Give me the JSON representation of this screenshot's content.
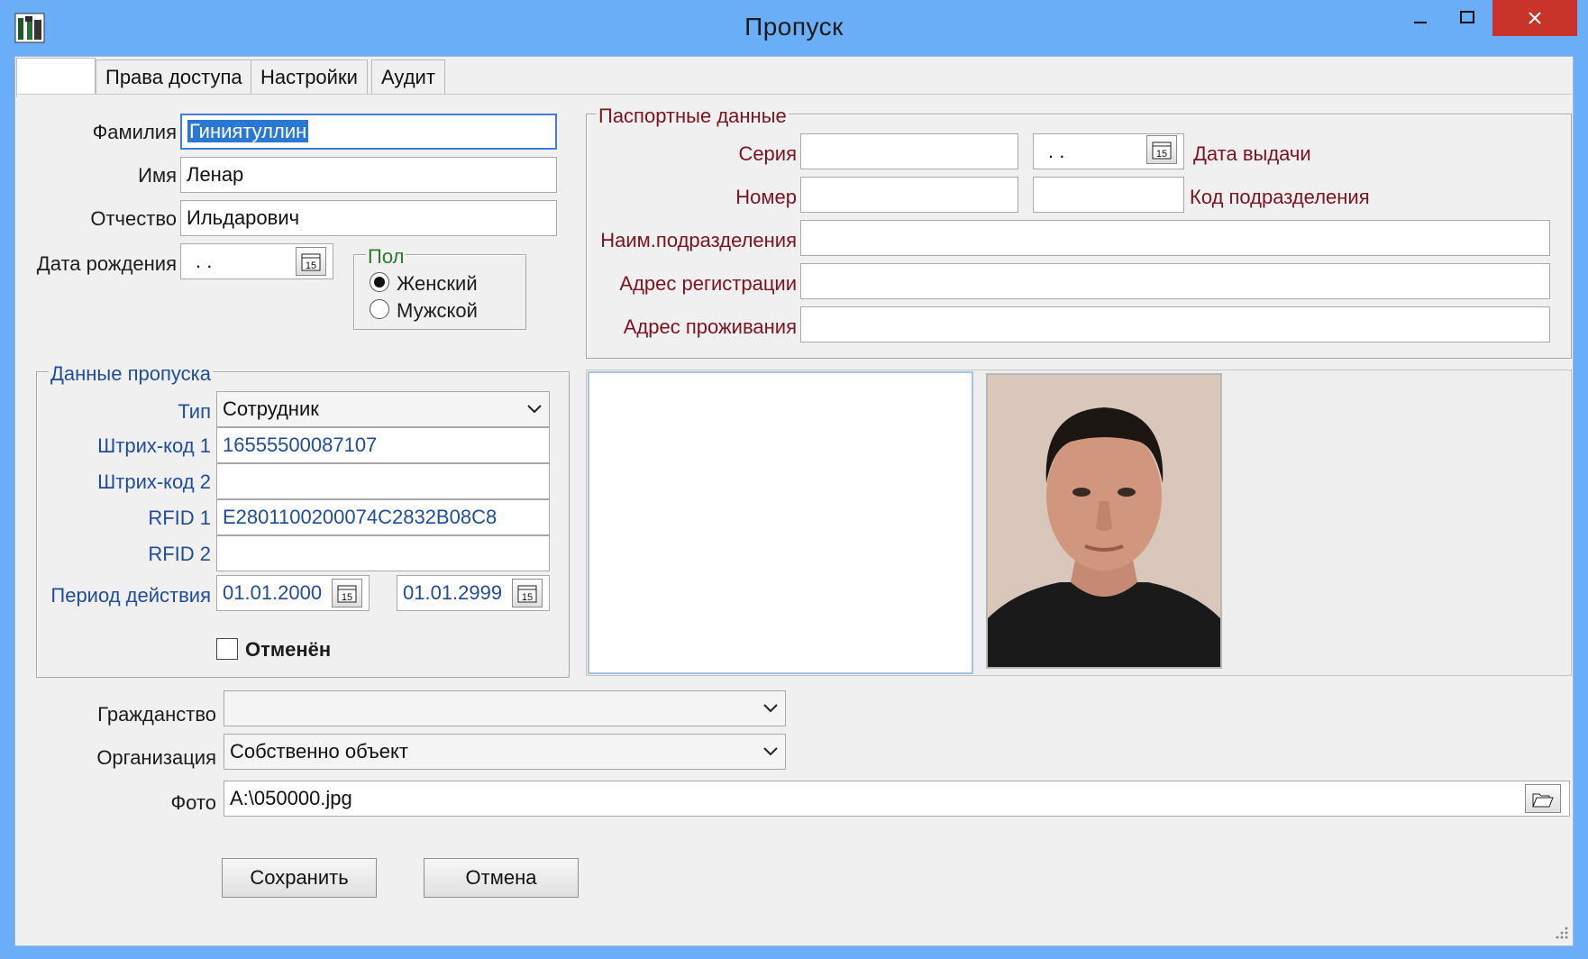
{
  "window": {
    "title": "Пропуск"
  },
  "tabs": [
    {
      "label": ""
    },
    {
      "label": "Права доступа"
    },
    {
      "label": "Настройки"
    },
    {
      "label": "Аудит"
    }
  ],
  "person": {
    "surname_label": "Фамилия",
    "surname_value": "Гиниятуллин",
    "name_label": "Имя",
    "name_value": "Ленар",
    "patronymic_label": "Отчество",
    "patronymic_value": "Ильдарович",
    "birth_label": "Дата рождения",
    "birth_value": ". ."
  },
  "gender": {
    "title": "Пол",
    "options": [
      {
        "label": "Женский",
        "selected": true
      },
      {
        "label": "Мужской",
        "selected": false
      }
    ]
  },
  "passport": {
    "title": "Паспортные данные",
    "series_label": "Серия",
    "series_value": "",
    "issue_date_value": ". .",
    "issue_date_label": "Дата выдачи",
    "number_label": "Номер",
    "number_value": "",
    "dept_code_value": "",
    "dept_code_label": "Код подразделения",
    "dept_name_label": "Наим.подразделения",
    "dept_name_value": "",
    "reg_addr_label": "Адрес регистрации",
    "reg_addr_value": "",
    "live_addr_label": "Адрес проживания",
    "live_addr_value": ""
  },
  "pass": {
    "title": "Данные пропуска",
    "type_label": "Тип",
    "type_value": "Сотрудник",
    "barcode1_label": "Штрих-код 1",
    "barcode1_value": "16555500087107",
    "barcode2_label": "Штрих-код 2",
    "barcode2_value": "",
    "rfid1_label": "RFID 1",
    "rfid1_value": "E2801100200074C2832B08C8",
    "rfid2_label": "RFID 2",
    "rfid2_value": "",
    "period_label": "Период действия",
    "period_from": "01.01.2000",
    "period_to": "01.01.2999",
    "cancelled_label": "Отменён",
    "cancelled_checked": false
  },
  "bottom": {
    "citizenship_label": "Гражданство",
    "citizenship_value": "",
    "org_label": "Организация",
    "org_value": "Собственно объект",
    "photo_label": "Фото",
    "photo_value": "A:\\050000.jpg"
  },
  "buttons": {
    "save": "Сохранить",
    "cancel": "Отмена"
  },
  "colors": {
    "titlebar": "#69aef6",
    "label_red": "#7a1420",
    "label_blue": "#1f4d9a",
    "close": "#c8332a"
  }
}
